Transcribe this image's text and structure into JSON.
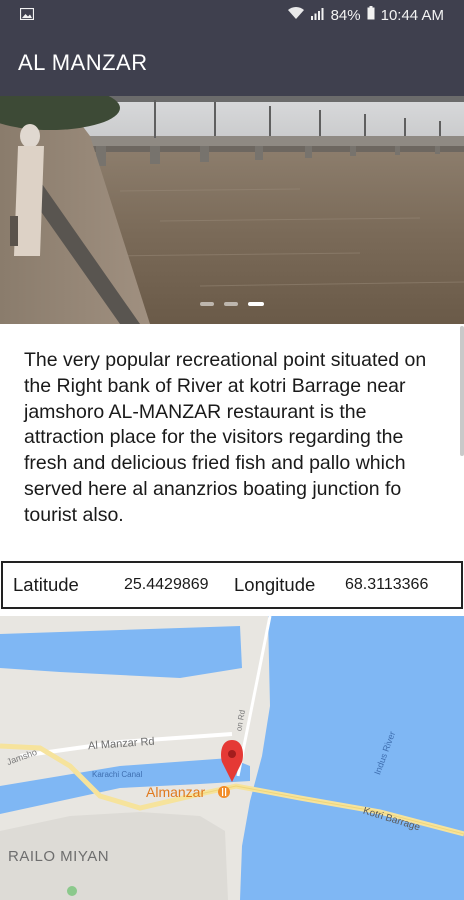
{
  "status_bar": {
    "battery": "84%",
    "time": "10:44 AM",
    "icons": [
      "image-icon",
      "wifi-icon",
      "signal-icon",
      "battery-icon"
    ]
  },
  "app_bar": {
    "title": "AL MANZAR"
  },
  "hero": {
    "image": "kotri-barrage-river-photo",
    "slides_total": 3,
    "active_slide": 3
  },
  "description": "The very popular recreational point situated on the Right bank of River at kotri Barrage near jamshoro AL-MANZAR restaurant is the attraction place for the visitors regarding the fresh and delicious fried fish and pallo which served here al ananzrios boating junction fo tourist also.",
  "coordinates": {
    "latitude_label": "Latitude",
    "latitude_value": "25.4429869",
    "longitude_label": "Longitude",
    "longitude_value": "68.3113366"
  },
  "map": {
    "place_label": "Almanzar",
    "road_label_1": "Al Manzar Rd",
    "road_label_2": "Jamsho",
    "canal_label": "Karachi Canal",
    "road_label_3": "Kotri Barrage",
    "river_label": "Indus River",
    "area_label": "RAILO MIYAN",
    "side_road_label": "on Rd",
    "colors": {
      "water": "#7fb7f4",
      "land": "#e8e6e1",
      "road": "#f6e39c",
      "pin": "#e53935"
    }
  }
}
